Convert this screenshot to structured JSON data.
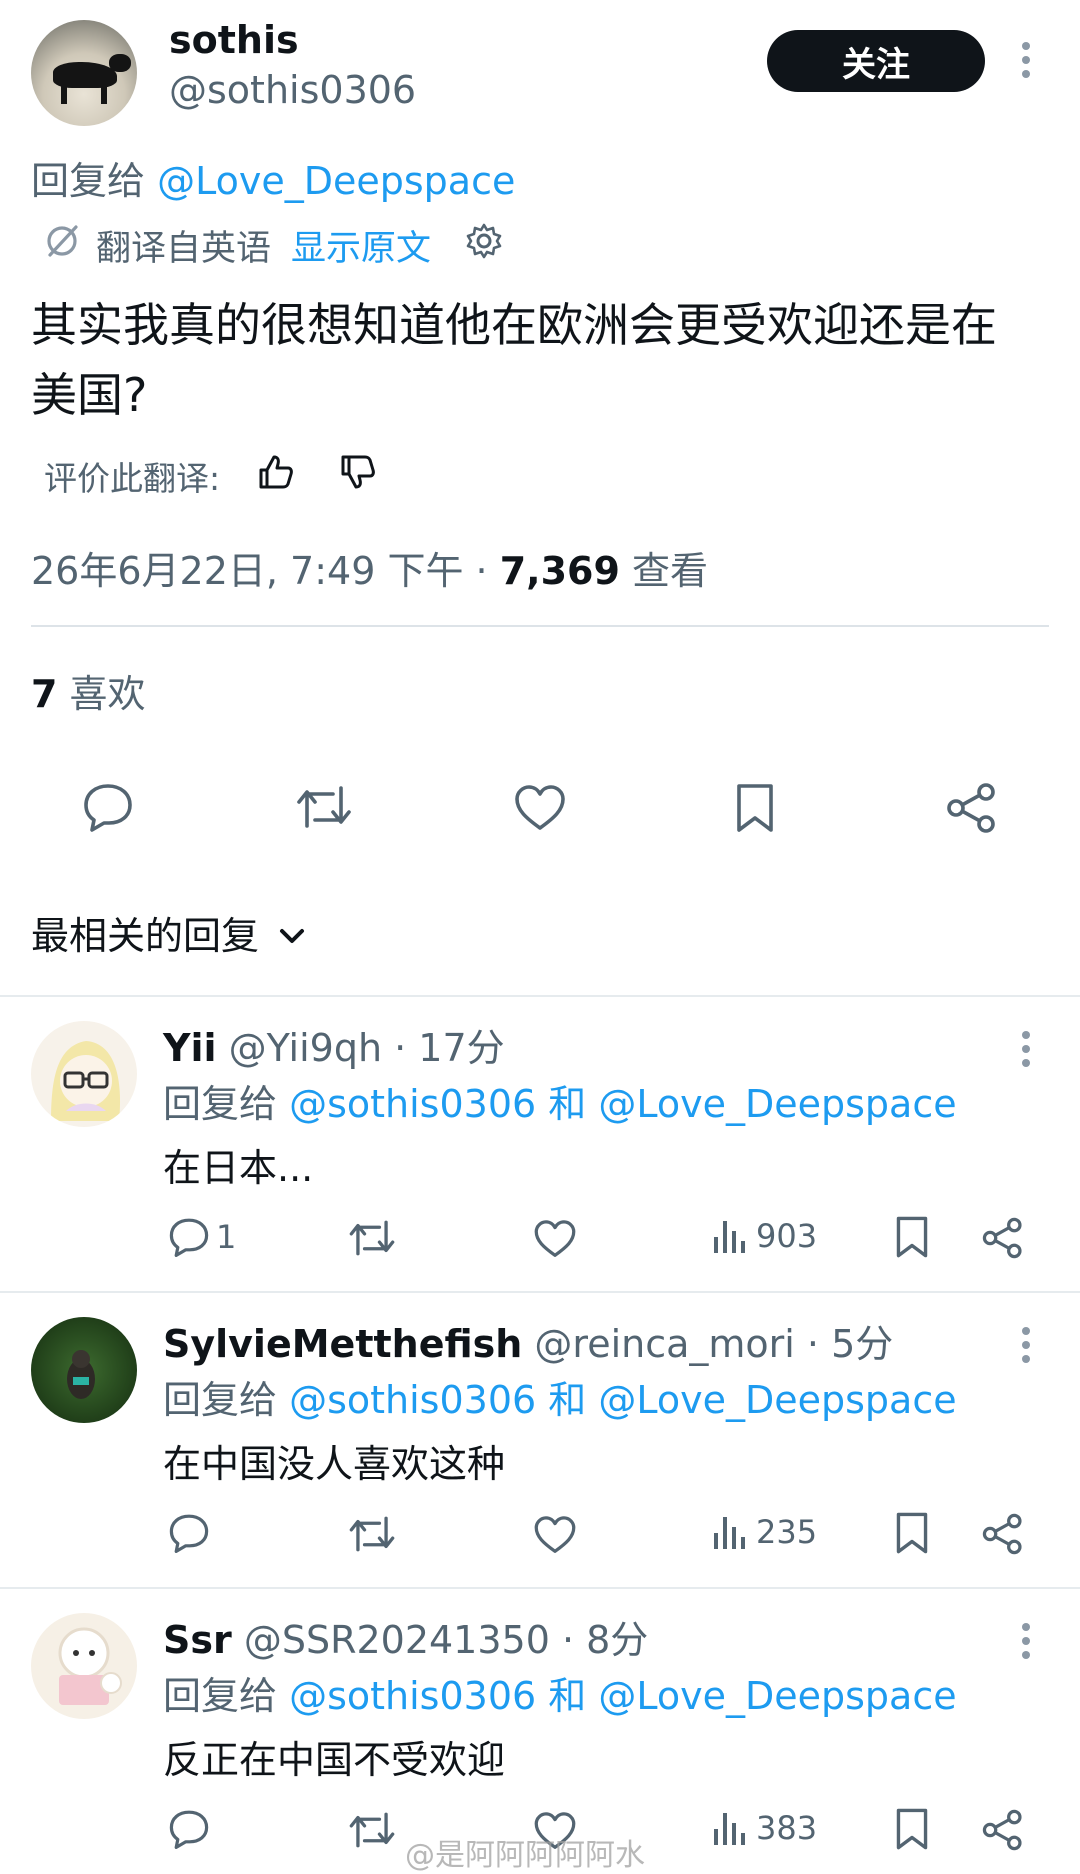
{
  "main_tweet": {
    "name": "sothis",
    "handle": "@sothis0306",
    "follow_label": "关注",
    "reply_to_prefix": "回复给",
    "reply_to_user": "@Love_Deepspace",
    "translated_from": "翻译自英语",
    "show_original": "显示原文",
    "text": "其实我真的很想知道他在欧洲会更受欢迎还是在美国?",
    "rate_translation": "评价此翻译:",
    "timestamp": "26年6月22日, 7:49 下午 · ",
    "views_count": "7,369",
    "views_label": " 查看",
    "likes_count": "7",
    "likes_label": " 喜欢"
  },
  "sort": {
    "label": "最相关的回复"
  },
  "replies": [
    {
      "name": "Yii",
      "handle": "@Yii9qh",
      "time": " · 17分",
      "reply_prefix": "回复给 ",
      "reply_user1": "@sothis0306",
      "reply_and": " 和 ",
      "reply_user2": "@Love_Deepspace",
      "text": "在日本...",
      "reply_count": "1",
      "views": "903"
    },
    {
      "name": "SylvieMetthefish",
      "handle": "@reinca_mori",
      "time": " · 5分",
      "reply_prefix": "回复给 ",
      "reply_user1": "@sothis0306",
      "reply_and": " 和 ",
      "reply_user2": "@Love_Deepspace",
      "text": "在中国没人喜欢这种",
      "reply_count": "",
      "views": "235"
    },
    {
      "name": "Ssr",
      "handle": "@SSR20241350",
      "time": " · 8分",
      "reply_prefix": "回复给 ",
      "reply_user1": "@sothis0306",
      "reply_and": " 和 ",
      "reply_user2": "@Love_Deepspace",
      "text": "反正在中国不受欢迎",
      "reply_count": "",
      "views": "383"
    }
  ],
  "watermark": "@是阿阿阿阿阿水",
  "colors": {
    "link": "#1d9bf0",
    "secondary_text": "#536471",
    "primary_text": "#0f1419",
    "follow_button_bg": "#0f1419"
  }
}
